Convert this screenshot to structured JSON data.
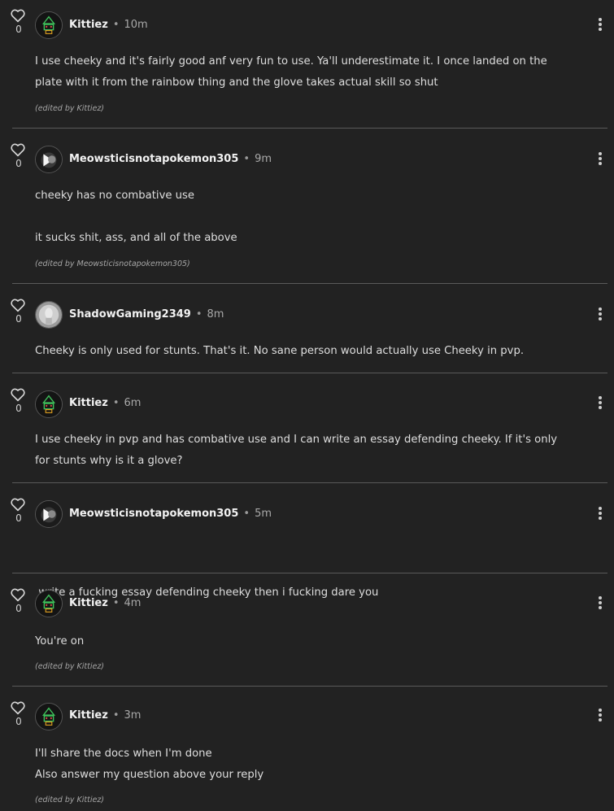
{
  "comments": [
    {
      "username": "Kittiez",
      "time": "10m",
      "votes": "0",
      "avatar": "kittiez-avatar",
      "body": [
        "I use cheeky and it's fairly good anf very fun to use. Ya'll underestimate it. I once landed on the",
        "plate with it from the rainbow thing and the glove takes actual skill so shut"
      ],
      "edited": "(edited by Kittiez)"
    },
    {
      "username": "Meowsticisnotapokemon305",
      "time": "9m",
      "votes": "0",
      "avatar": "meowstic-avatar",
      "body": [
        "cheeky has no combative use",
        "it sucks shit, ass, and all of the above"
      ],
      "edited": "(edited by Meowsticisnotapokemon305)"
    },
    {
      "username": "ShadowGaming2349",
      "time": "8m",
      "votes": "0",
      "avatar": "shadow-avatar",
      "body": [
        "Cheeky is only used for stunts. That's it. No sane person would actually use Cheeky in pvp."
      ],
      "edited": ""
    },
    {
      "username": "Kittiez",
      "time": "6m",
      "votes": "0",
      "avatar": "kittiez-avatar",
      "body": [
        "I use cheeky in pvp and has combative use and I can write an essay defending cheeky. If it's only",
        "for stunts why is it a glove?"
      ],
      "edited": ""
    },
    {
      "username": "Meowsticisnotapokemon305",
      "time": "5m",
      "votes": "0",
      "avatar": "meowstic-avatar",
      "body": [
        " write a fucking essay defending cheeky then i fucking dare you"
      ],
      "edited": ""
    },
    {
      "username": "Kittiez",
      "time": "4m",
      "votes": "0",
      "avatar": "kittiez-avatar",
      "body": [
        "You're on"
      ],
      "edited": "(edited by Kittiez)"
    },
    {
      "username": "Kittiez",
      "time": "3m",
      "votes": "0",
      "avatar": "kittiez-avatar",
      "body": [
        "I'll share the docs when I'm done",
        "Also answer my question above your reply"
      ],
      "edited": "(edited by Kittiez)"
    }
  ]
}
